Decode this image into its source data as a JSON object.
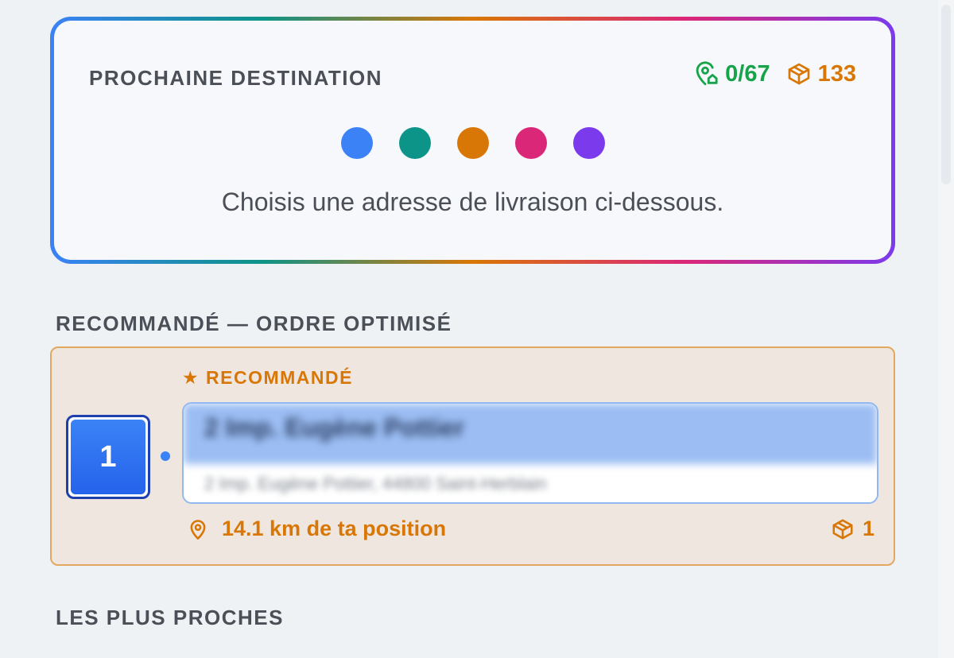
{
  "next_destination": {
    "title": "PROCHAINE DESTINATION",
    "stops_progress": "0/67",
    "parcels_total": "133",
    "hint": "Choisis une adresse de livraison ci-dessous.",
    "dot_colors": [
      "#3b82f6",
      "#0d9488",
      "#d97706",
      "#db2777",
      "#7c3aed"
    ]
  },
  "recommended_section": {
    "title": "RECOMMANDÉ — ORDRE OPTIMISÉ",
    "card": {
      "badge": "★ RECOMMANDÉ",
      "order_number": "1",
      "address_title": "2 Imp. Eugène Pottier",
      "address_full": "2 Imp. Eugène Pottier, 44800 Saint-Herblain",
      "distance": "14.1 km de ta position",
      "parcels": "1"
    }
  },
  "nearest_section": {
    "title": "LES PLUS PROCHES"
  },
  "colors": {
    "accent_orange": "#d97706",
    "accent_green": "#16a34a",
    "accent_blue": "#3b82f6"
  }
}
